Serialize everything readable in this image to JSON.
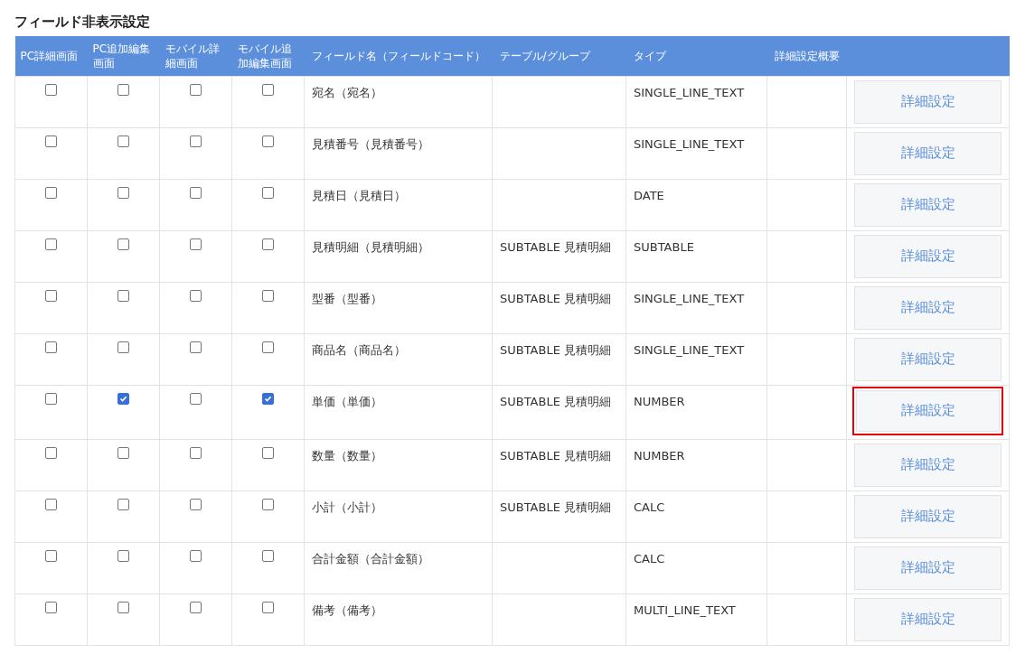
{
  "title": "フィールド非表示設定",
  "columns": [
    "PC詳細画面",
    "PC追加編集画面",
    "モバイル詳細画面",
    "モバイル追加編集画面",
    "フィールド名（フィールドコード）",
    "テーブル/グループ",
    "タイプ",
    "詳細設定概要"
  ],
  "rows": [
    {
      "checks": [
        false,
        false,
        false,
        false
      ],
      "field": "宛名（宛名）",
      "group": "",
      "type": "SINGLE_LINE_TEXT",
      "button": "詳細設定",
      "highlighted": false
    },
    {
      "checks": [
        false,
        false,
        false,
        false
      ],
      "field": "見積番号（見積番号）",
      "group": "",
      "type": "SINGLE_LINE_TEXT",
      "button": "詳細設定",
      "highlighted": false
    },
    {
      "checks": [
        false,
        false,
        false,
        false
      ],
      "field": "見積日（見積日）",
      "group": "",
      "type": "DATE",
      "button": "詳細設定",
      "highlighted": false
    },
    {
      "checks": [
        false,
        false,
        false,
        false
      ],
      "field": "見積明細（見積明細）",
      "group": "SUBTABLE 見積明細",
      "type": "SUBTABLE",
      "button": "詳細設定",
      "highlighted": false
    },
    {
      "checks": [
        false,
        false,
        false,
        false
      ],
      "field": "型番（型番）",
      "group": "SUBTABLE 見積明細",
      "type": "SINGLE_LINE_TEXT",
      "button": "詳細設定",
      "highlighted": false
    },
    {
      "checks": [
        false,
        false,
        false,
        false
      ],
      "field": "商品名（商品名）",
      "group": "SUBTABLE 見積明細",
      "type": "SINGLE_LINE_TEXT",
      "button": "詳細設定",
      "highlighted": false
    },
    {
      "checks": [
        false,
        true,
        false,
        true
      ],
      "field": "単価（単価）",
      "group": "SUBTABLE 見積明細",
      "type": "NUMBER",
      "button": "詳細設定",
      "highlighted": true
    },
    {
      "checks": [
        false,
        false,
        false,
        false
      ],
      "field": "数量（数量）",
      "group": "SUBTABLE 見積明細",
      "type": "NUMBER",
      "button": "詳細設定",
      "highlighted": false
    },
    {
      "checks": [
        false,
        false,
        false,
        false
      ],
      "field": "小計（小計）",
      "group": "SUBTABLE 見積明細",
      "type": "CALC",
      "button": "詳細設定",
      "highlighted": false
    },
    {
      "checks": [
        false,
        false,
        false,
        false
      ],
      "field": "合計金額（合計金額）",
      "group": "",
      "type": "CALC",
      "button": "詳細設定",
      "highlighted": false
    },
    {
      "checks": [
        false,
        false,
        false,
        false
      ],
      "field": "備考（備考）",
      "group": "",
      "type": "MULTI_LINE_TEXT",
      "button": "詳細設定",
      "highlighted": false
    }
  ]
}
